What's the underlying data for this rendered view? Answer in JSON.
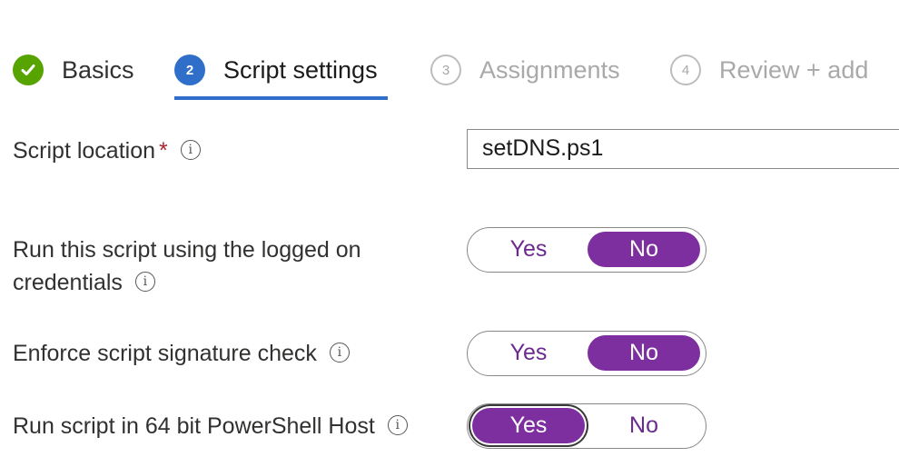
{
  "wizard": {
    "steps": [
      {
        "number": "",
        "label": "Basics",
        "state": "completed"
      },
      {
        "number": "2",
        "label": "Script settings",
        "state": "current"
      },
      {
        "number": "3",
        "label": "Assignments",
        "state": "future"
      },
      {
        "number": "4",
        "label": "Review + add",
        "state": "future"
      }
    ]
  },
  "form": {
    "script_location": {
      "label": "Script location",
      "required_marker": "*",
      "value": "setDNS.ps1",
      "info_icon": "info-icon"
    },
    "logged_on_credentials": {
      "label_line1": "Run this script using the logged on",
      "label_line2": "credentials",
      "yes_label": "Yes",
      "no_label": "No",
      "selected": "No"
    },
    "signature_check": {
      "label": "Enforce script signature check",
      "yes_label": "Yes",
      "no_label": "No",
      "selected": "No"
    },
    "bit64_host": {
      "label": "Run script in 64 bit PowerShell Host",
      "yes_label": "Yes",
      "no_label": "No",
      "selected": "Yes"
    }
  },
  "colors": {
    "completed_green": "#57a300",
    "current_blue": "#2f6fca",
    "toggle_purple": "#7d2f9f",
    "required_red": "#a4262c"
  }
}
